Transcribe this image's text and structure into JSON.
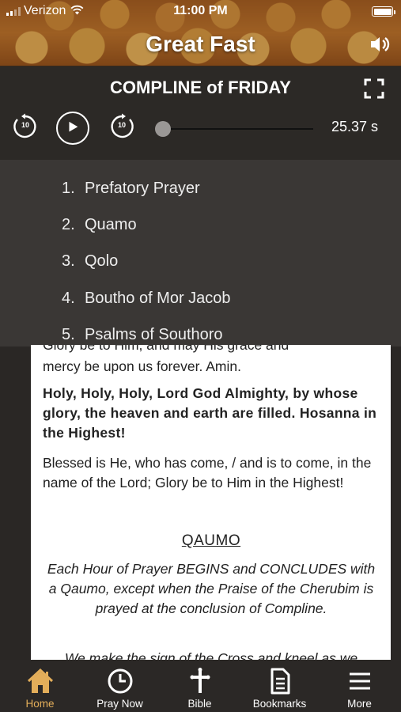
{
  "status_bar": {
    "carrier": "Verizon",
    "time": "11:00 PM",
    "wifi_icon": "wifi-icon",
    "battery_icon": "battery-icon"
  },
  "header": {
    "title": "Great Fast",
    "speaker_icon": "speaker-icon"
  },
  "player": {
    "service_title": "COMPLINE of FRIDAY",
    "rewind_seconds": "10",
    "forward_seconds": "10",
    "duration": "25.37 s",
    "progress": 0.0
  },
  "sections": [
    {
      "num": "1.",
      "label": "Prefatory Prayer"
    },
    {
      "num": "2.",
      "label": "Quamo"
    },
    {
      "num": "3.",
      "label": "Qolo"
    },
    {
      "num": "4.",
      "label": "Boutho of Mor Jacob"
    },
    {
      "num": "5.",
      "label": "Psalms of Southoro"
    }
  ],
  "content": {
    "partial_top": "Glory be to Him, and may His grace and",
    "para1_end": "mercy be upon us forever. Amin.",
    "para2": "Holy, Holy, Holy, Lord God Almighty, by whose glory, the heaven and earth are filled. Hosanna in the Highest!",
    "para3": "Blessed is He, who has come, / and is to come, in the name of the Lord; Glory be to Him in the Highest!",
    "heading": "QAUMO",
    "instruction": "Each Hour of Prayer BEGINS and CONCLUDES with a Qaumo, except when the Praise of the Cherubim is prayed at the conclusion of Compline.",
    "partial_bottom": "We make the sign of the Cross and kneel as we"
  },
  "tabs": [
    {
      "label": "Home",
      "icon": "home-icon",
      "active": true
    },
    {
      "label": "Pray Now",
      "icon": "clock-icon",
      "active": false
    },
    {
      "label": "Bible",
      "icon": "cross-icon",
      "active": false
    },
    {
      "label": "Bookmarks",
      "icon": "document-icon",
      "active": false
    },
    {
      "label": "More",
      "icon": "menu-icon",
      "active": false
    }
  ],
  "colors": {
    "accent": "#e3ae5a",
    "header_bg": "#b7722d",
    "panel_bg": "#2c2926",
    "list_bg": "#3a3735"
  }
}
